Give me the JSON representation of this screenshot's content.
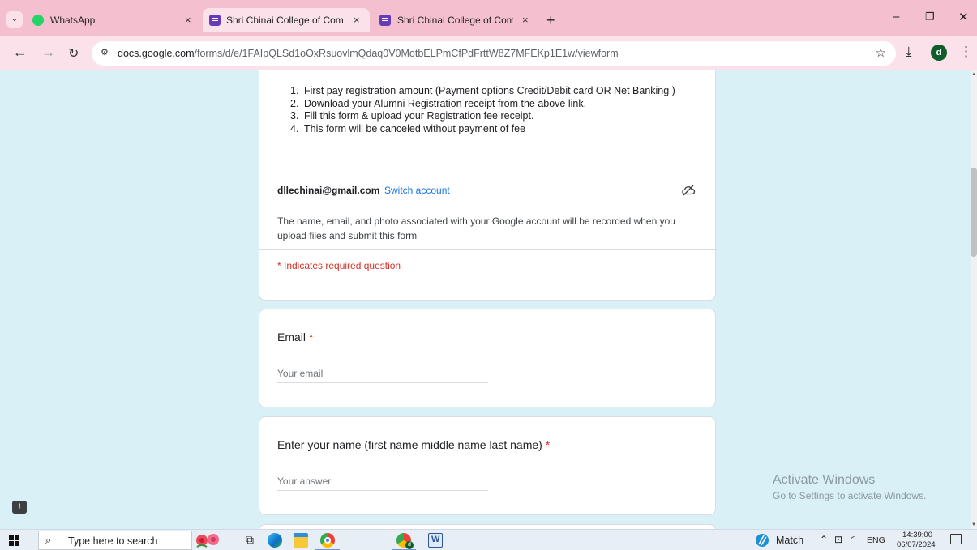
{
  "browser": {
    "tabs": [
      {
        "label": "WhatsApp",
        "icon": "whatsapp-icon",
        "active": false
      },
      {
        "label": "Shri Chinai College of Com.& E",
        "icon": "google-forms-icon",
        "active": true
      },
      {
        "label": "Shri Chinai College of Com.& E",
        "icon": "google-forms-icon",
        "active": false
      }
    ],
    "close_glyph": "×",
    "new_tab_glyph": "+",
    "url_host": "docs.google.com",
    "url_path": "/forms/d/e/1FAIpQLSd1oOxRsuovlmQdaq0V0MotbELPmCfPdFrttW8Z7MFEKp1E1w/viewform",
    "profile_initial": "d"
  },
  "form": {
    "instructions": [
      {
        "num": "1.",
        "text": "First pay registration amount  (Payment options Credit/Debit card OR Net Banking )"
      },
      {
        "num": "2.",
        "text": "Download your Alumni Registration receipt from the above link."
      },
      {
        "num": "3.",
        "text": "Fill this form & upload your Registration fee receipt."
      },
      {
        "num": "4.",
        "text": "This form will be canceled without payment of fee"
      }
    ],
    "account_email": "dllechinai@gmail.com",
    "switch_account": "Switch account",
    "notice": "The name, email, and photo associated with your Google account will be recorded when you upload files and submit this form",
    "required_note": "* Indicates required question",
    "questions": [
      {
        "title": "Email",
        "required_mark": "*",
        "placeholder": "Your email"
      },
      {
        "title": "Enter your name (first name middle name last name)",
        "required_mark": "*",
        "placeholder": "Your answer"
      }
    ]
  },
  "watermark": {
    "title": "Activate Windows",
    "subtitle": "Go to Settings to activate Windows."
  },
  "taskbar": {
    "search_placeholder": "Type here to search",
    "weather_label": "Match",
    "language": "ENG",
    "time": "14:39:00",
    "date": "06/07/2024"
  },
  "colors": {
    "tabstrip": "#f4c0d0",
    "toolbar": "#fbe2ea",
    "page_background": "#d9f0f7",
    "required_red": "#d93025",
    "link_blue": "#1a73e8"
  }
}
